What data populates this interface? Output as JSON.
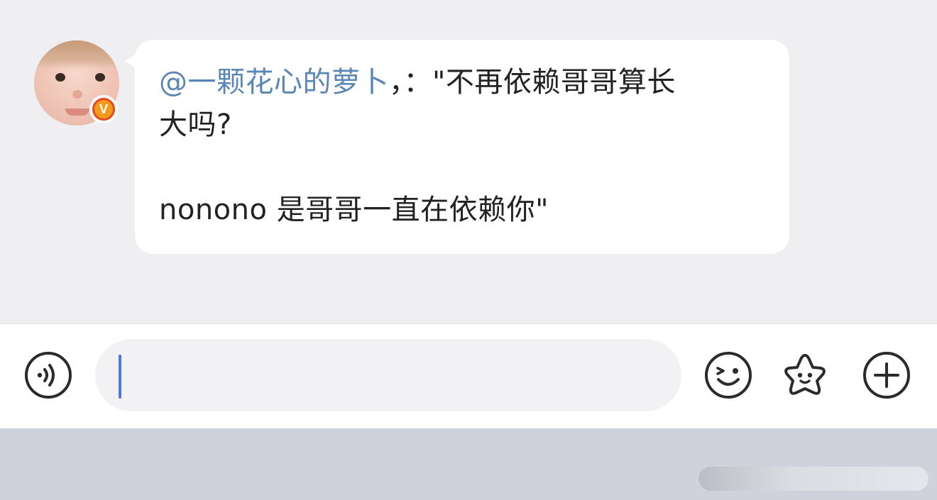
{
  "message": {
    "mention": "@一颗花心的萝卜",
    "line1_rest": "，：\"不再依赖哥哥算长",
    "line2": "大吗?",
    "line3": "nonono 是哥哥一直在依赖你\""
  },
  "sender": {
    "verify_badge": "V"
  },
  "input_bar": {
    "placeholder": "",
    "value": ""
  },
  "icons": {
    "voice": "voice-icon",
    "emoji": "emoji-icon",
    "sticker": "sticker-icon",
    "more": "plus-icon"
  },
  "colors": {
    "mention": "#5a86b5",
    "caret": "#4a78e0",
    "badge": "#f49a1a"
  }
}
